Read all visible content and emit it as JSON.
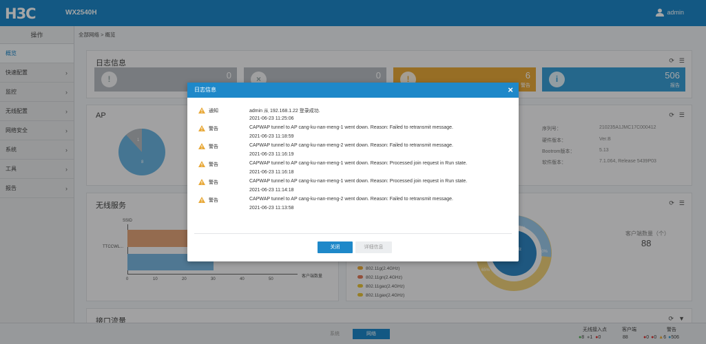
{
  "header": {
    "logo": "H3C",
    "model": "WX2540H",
    "user": "admin"
  },
  "sidebar": {
    "title": "操作",
    "items": [
      {
        "label": "概览"
      },
      {
        "label": "快速配置"
      },
      {
        "label": "监控"
      },
      {
        "label": "无线配置"
      },
      {
        "label": "网络安全"
      },
      {
        "label": "系统"
      },
      {
        "label": "工具"
      },
      {
        "label": "报告"
      }
    ]
  },
  "breadcrumb": "全部网络 > 概览",
  "log_panel": {
    "title": "日志信息",
    "stats": [
      {
        "value": "0",
        "color": "#b8bec4"
      },
      {
        "value": "0",
        "color": "#b8bec4"
      },
      {
        "value": "6",
        "label": "警告",
        "color": "#e8a93a"
      },
      {
        "value": "506",
        "label": "报告",
        "color": "#3a9fd6"
      }
    ]
  },
  "ap_panel": {
    "title": "AP",
    "pie_labels": [
      "1",
      "8"
    ],
    "info": [
      {
        "label": "序列号：",
        "value": "210235A1JMC17C000412"
      },
      {
        "label": "硬件版本：",
        "value": "Ver.B"
      },
      {
        "label": "Bootrom版本：",
        "value": "5.13"
      },
      {
        "label": "软件版本：",
        "value": "7.1.064, Release 5439P03"
      }
    ]
  },
  "wireless_panel": {
    "title": "无线服务",
    "y_axis_label": "SSID",
    "category": "TTCCWL...",
    "x_ticks": [
      "0",
      "10",
      "20",
      "30",
      "40",
      "50"
    ],
    "x_axis_label": "客户端数量",
    "legend": [
      "802.11g(2.4GHz)",
      "802.11gn(2.4GHz)",
      "802.11gac(2.4GHz)",
      "802.11gax(2.4GHz)"
    ],
    "legend_colors": [
      "#e8a93a",
      "#e07a5a",
      "#e8c33a",
      "#e8c33a"
    ],
    "donut_labels": [
      "14%",
      "10%",
      "GHz",
      "65%"
    ],
    "client_count_label": "客户端数量（个）",
    "client_count": "88"
  },
  "iface_panel": {
    "title": "接口流量"
  },
  "bottom": {
    "system_label": "系统",
    "network_label": "网络",
    "ap_label": "无线接入点",
    "ap_counts": [
      "8",
      "1",
      "0"
    ],
    "client_label": "客户端",
    "client_count": "88",
    "alarm_label": "警告",
    "alarm_counts": [
      "0",
      "0",
      "6",
      "506"
    ]
  },
  "modal": {
    "title": "日志信息",
    "entries": [
      {
        "level": "通知",
        "message": "admin 从 192.168.1.22 登录成功.",
        "time": "2021-06-23 11:25:06"
      },
      {
        "level": "警告",
        "message": "CAPWAP tunnel to AP cang-ku-nan-meng-1 went down. Reason: Failed to retransmit message.",
        "time": "2021-06-23 11:18:59"
      },
      {
        "level": "警告",
        "message": "CAPWAP tunnel to AP cang-ku-nan-meng-2 went down. Reason: Failed to retransmit message.",
        "time": "2021-06-23 11:16:19"
      },
      {
        "level": "警告",
        "message": "CAPWAP tunnel to AP cang-ku-nan-meng-1 went down. Reason: Processed join request in Run state.",
        "time": "2021-06-23 11:16:18"
      },
      {
        "level": "警告",
        "message": "CAPWAP tunnel to AP cang-ku-nan-meng-1 went down. Reason: Processed join request in Run state.",
        "time": "2021-06-23 11:14:18"
      },
      {
        "level": "警告",
        "message": "CAPWAP tunnel to AP cang-ku-nan-meng-2 went down. Reason: Failed to retransmit message.",
        "time": "2021-06-23 11:13:58"
      }
    ],
    "close_button": "关闭",
    "detail_button": "详细信息"
  }
}
